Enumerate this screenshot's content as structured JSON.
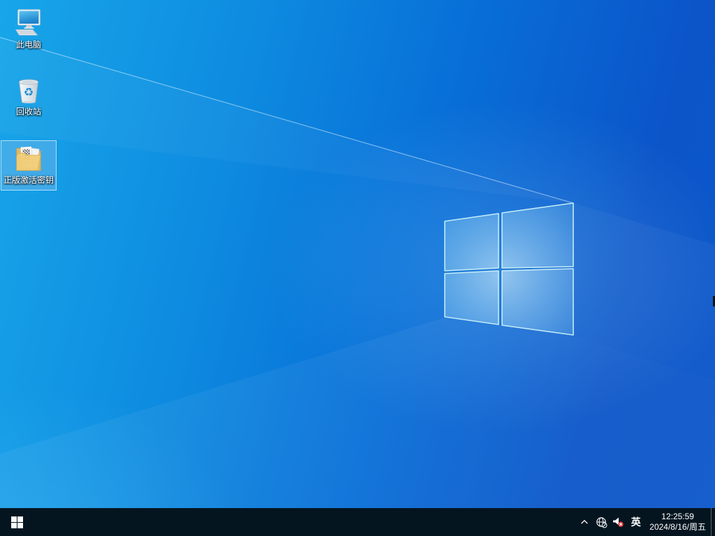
{
  "wallpaper": {
    "base_light": "#18a6e9",
    "base_dark": "#0b55c9",
    "logo_border_color": "#c9f0f8",
    "windows_logo": "windows-10-light-watermark"
  },
  "desktop": {
    "recycle_glyph": "♻",
    "icons": [
      {
        "label": "此电脑",
        "selected": false
      },
      {
        "label": "回收站",
        "selected": false
      },
      {
        "label": "正版激活密钥",
        "selected": true
      }
    ]
  },
  "taskbar": {
    "background": "#041520",
    "ime_indicator": "英",
    "clock": {
      "time": "12:25:59",
      "date": "2024/8/16/周五"
    },
    "tray_icon_names": [
      "hidden-icons-chevron",
      "network-globe-disconnected",
      "volume-muted",
      "ime-mode",
      "clock",
      "show-desktop"
    ]
  }
}
